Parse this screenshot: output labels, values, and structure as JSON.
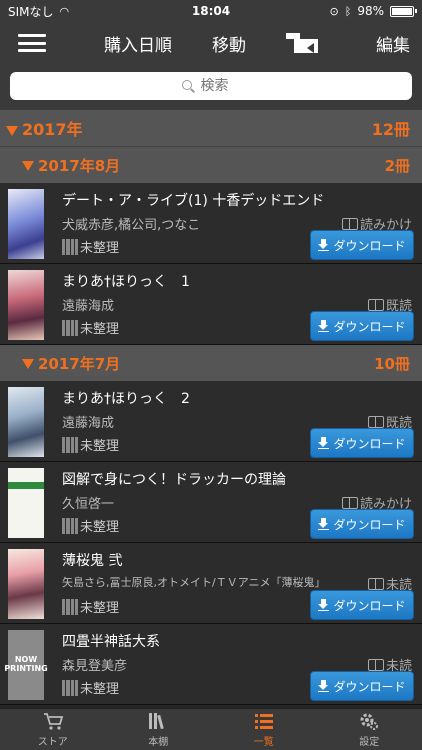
{
  "status_bar": {
    "carrier": "SIMなし",
    "time": "18:04",
    "battery": "98%"
  },
  "nav": {
    "sort_label": "購入日順",
    "move_label": "移動",
    "edit_label": "編集"
  },
  "search": {
    "placeholder": "検索"
  },
  "year_group": {
    "label": "2017年",
    "count": "12冊"
  },
  "month_groups": [
    {
      "label": "2017年8月",
      "count": "2冊",
      "books": [
        {
          "title": "デート・ア・ライブ(1) 十香デッドエンド",
          "author": "犬威赤彦,橘公司,つなこ",
          "status": "読みかけ",
          "shelf": "未整理",
          "download": "ダウンロード"
        },
        {
          "title": "まりあ†ほりっく　1",
          "author": "遠藤海成",
          "status": "既読",
          "shelf": "未整理",
          "download": "ダウンロード"
        }
      ]
    },
    {
      "label": "2017年7月",
      "count": "10冊",
      "books": [
        {
          "title": "まりあ†ほりっく　2",
          "author": "遠藤海成",
          "status": "既読",
          "shelf": "未整理",
          "download": "ダウンロード"
        },
        {
          "title": "図解で身につく！ドラッカーの理論",
          "author": "久恒啓一",
          "status": "読みかけ",
          "shelf": "未整理",
          "download": "ダウンロード"
        },
        {
          "title": "薄桜鬼 弐",
          "author": "矢島さら,冨士原良,オトメイト/ＴＶアニメ「薄桜鬼」製…",
          "status": "未読",
          "shelf": "未整理",
          "download": "ダウンロード"
        },
        {
          "title": "四畳半神話大系",
          "author": "森見登美彦",
          "status": "未読",
          "shelf": "未整理",
          "download": "ダウンロード",
          "cover_text": "NOW PRINTING"
        }
      ]
    }
  ],
  "tabs": [
    {
      "label": "ストア",
      "icon": "cart-icon"
    },
    {
      "label": "本棚",
      "icon": "bookshelf-icon"
    },
    {
      "label": "一覧",
      "icon": "list-icon"
    },
    {
      "label": "設定",
      "icon": "gear-icon"
    }
  ],
  "colors": {
    "accent": "#f07020",
    "download_button": "#1c78c4",
    "bar": "#3a3a3a"
  }
}
